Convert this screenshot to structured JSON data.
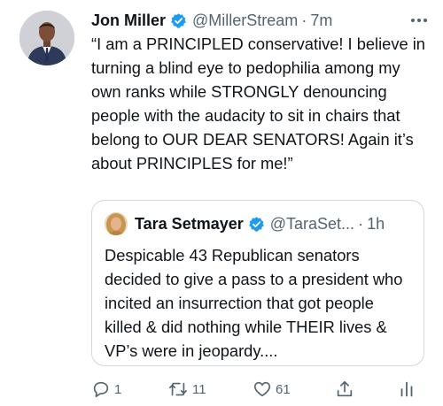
{
  "tweet": {
    "author_name": "Jon Miller",
    "author_handle": "@MillerStream",
    "separator": "·",
    "time": "7m",
    "text": "“I am a PRINCIPLED conservative! I believe in turning a blind eye to pedophilia among my own ranks while STRONGLY denouncing people with the audacity to sit in chairs that belong to OUR DEAR SENATORS! Again it’s about PRINCIPLES for me!”"
  },
  "quoted_tweet": {
    "author_name": "Tara Setmayer",
    "author_handle": "@TaraSet...",
    "separator": "·",
    "time": "1h",
    "text": "Despicable 43 Republican senators decided to give a pass to a president who incited an insurrection that got people killed & did nothing while THEIR lives & VP’s were in jeopardy...."
  },
  "actions": {
    "reply_count": "1",
    "retweet_count": "11",
    "like_count": "61"
  },
  "colors": {
    "verified": "#1d9bf0",
    "secondary_text": "#536471",
    "border": "#cfd9de"
  },
  "icons": [
    "verified-badge-icon",
    "more-icon",
    "reply-icon",
    "retweet-icon",
    "like-icon",
    "share-icon",
    "analytics-icon"
  ]
}
